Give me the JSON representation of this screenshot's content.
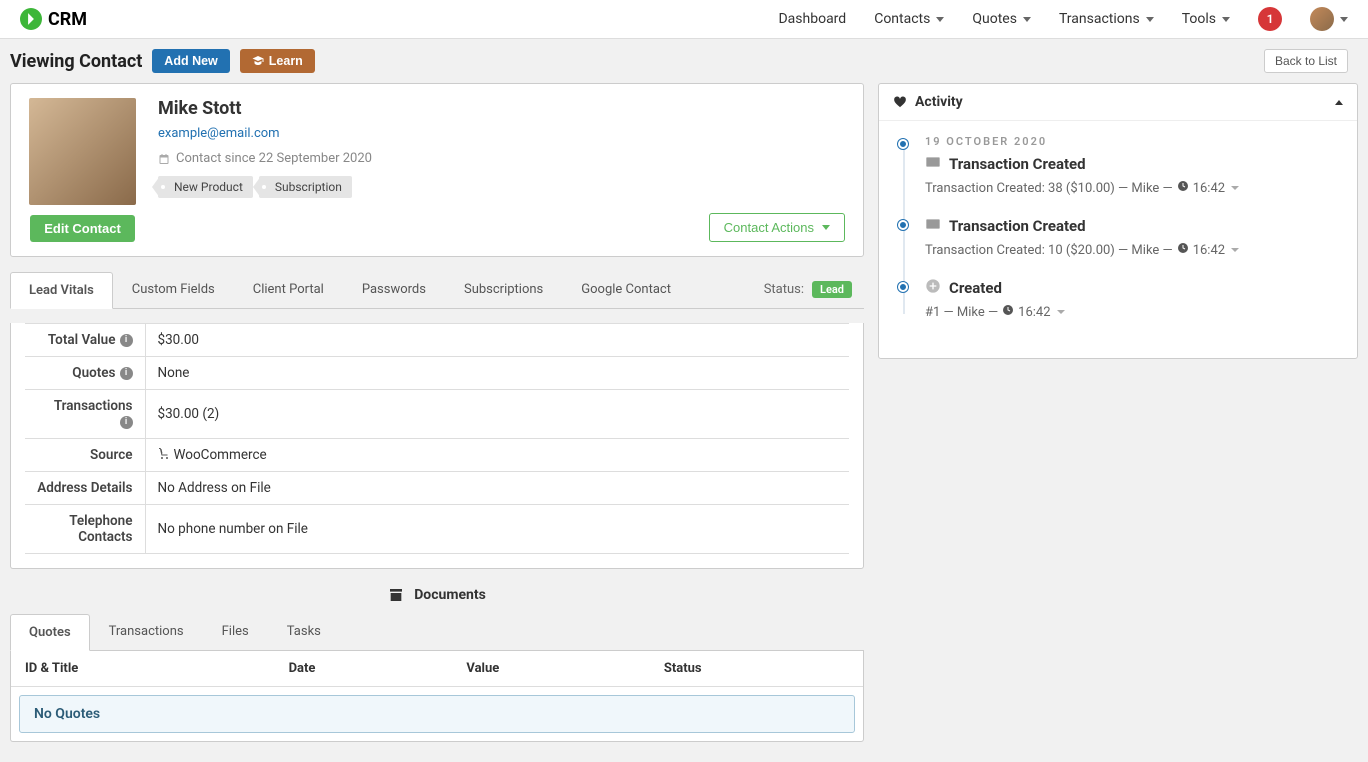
{
  "brand": "CRM",
  "topnav": {
    "dashboard": "Dashboard",
    "contacts": "Contacts",
    "quotes": "Quotes",
    "transactions": "Transactions",
    "tools": "Tools",
    "notification_count": "1"
  },
  "subheader": {
    "title": "Viewing Contact",
    "add_new": "Add New",
    "learn": "Learn",
    "back": "Back to List"
  },
  "contact": {
    "name": "Mike Stott",
    "email": "example@email.com",
    "since": "Contact since 22 September 2020",
    "tags": [
      "New Product",
      "Subscription"
    ],
    "edit": "Edit Contact",
    "actions": "Contact Actions"
  },
  "tabs": [
    "Lead Vitals",
    "Custom Fields",
    "Client Portal",
    "Passwords",
    "Subscriptions",
    "Google Contact"
  ],
  "status": {
    "label": "Status:",
    "value": "Lead"
  },
  "vitals": {
    "rows": [
      {
        "label": "Total Value",
        "value": "$30.00",
        "info": true
      },
      {
        "label": "Quotes",
        "value": "None",
        "info": true
      },
      {
        "label": "Transactions",
        "value": "$30.00 (2)",
        "info": true
      },
      {
        "label": "Source",
        "value": "WooCommerce",
        "cart": true
      },
      {
        "label": "Address Details",
        "value": "No Address on File"
      },
      {
        "label": "Telephone Contacts",
        "value": "No phone number on File"
      }
    ]
  },
  "documents": {
    "heading": "Documents",
    "tabs": [
      "Quotes",
      "Transactions",
      "Files",
      "Tasks"
    ],
    "columns": [
      "ID & Title",
      "Date",
      "Value",
      "Status"
    ],
    "empty": "No Quotes"
  },
  "activity": {
    "heading": "Activity",
    "date": "19 OCTOBER 2020",
    "items": [
      {
        "title": "Transaction Created",
        "icon": "card",
        "meta": "Transaction Created: 38 ($10.00) — Mike —",
        "time": "16:42"
      },
      {
        "title": "Transaction Created",
        "icon": "card",
        "meta": "Transaction Created: 10 ($20.00) — Mike —",
        "time": "16:42"
      },
      {
        "title": "Created",
        "icon": "plus",
        "meta": "#1 — Mike —",
        "time": "16:42"
      }
    ]
  }
}
